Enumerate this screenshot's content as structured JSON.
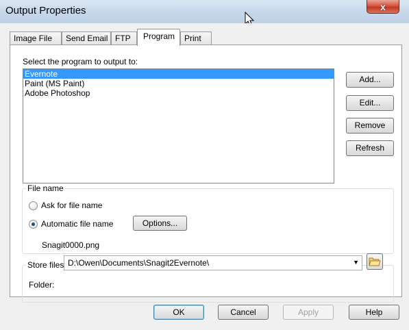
{
  "window": {
    "title": "Output Properties",
    "close_glyph": "x"
  },
  "tabs": [
    {
      "label": "Image File"
    },
    {
      "label": "Send Email"
    },
    {
      "label": "FTP"
    },
    {
      "label": "Program",
      "active": true
    },
    {
      "label": "Print"
    }
  ],
  "program": {
    "label": "Select the program to output to:",
    "items": [
      "Evernote",
      "Paint (MS Paint)",
      "Adobe Photoshop"
    ],
    "selected": "Evernote",
    "buttons": {
      "add": "Add...",
      "edit": "Edit...",
      "remove": "Remove",
      "refresh": "Refresh"
    }
  },
  "file_name": {
    "legend": "File name",
    "ask_label": "Ask for file name",
    "auto_label": "Automatic file name",
    "selected_option": "Automatic file name",
    "options_button": "Options...",
    "preview": "Snagit0000.png"
  },
  "store": {
    "legend": "Store files in",
    "folder_label": "Folder:",
    "folder_value": "D:\\Owen\\Documents\\Snagit2Evernote\\"
  },
  "footer": {
    "ok": "OK",
    "cancel": "Cancel",
    "apply": "Apply",
    "help": "Help"
  },
  "colors": {
    "selection": "#3399ff",
    "close_button": "#c23a22",
    "titlebar": "#c6d7ea"
  },
  "icons": [
    "close-icon",
    "cursor-arrow-icon",
    "dropdown-arrow-icon",
    "folder-open-icon"
  ]
}
